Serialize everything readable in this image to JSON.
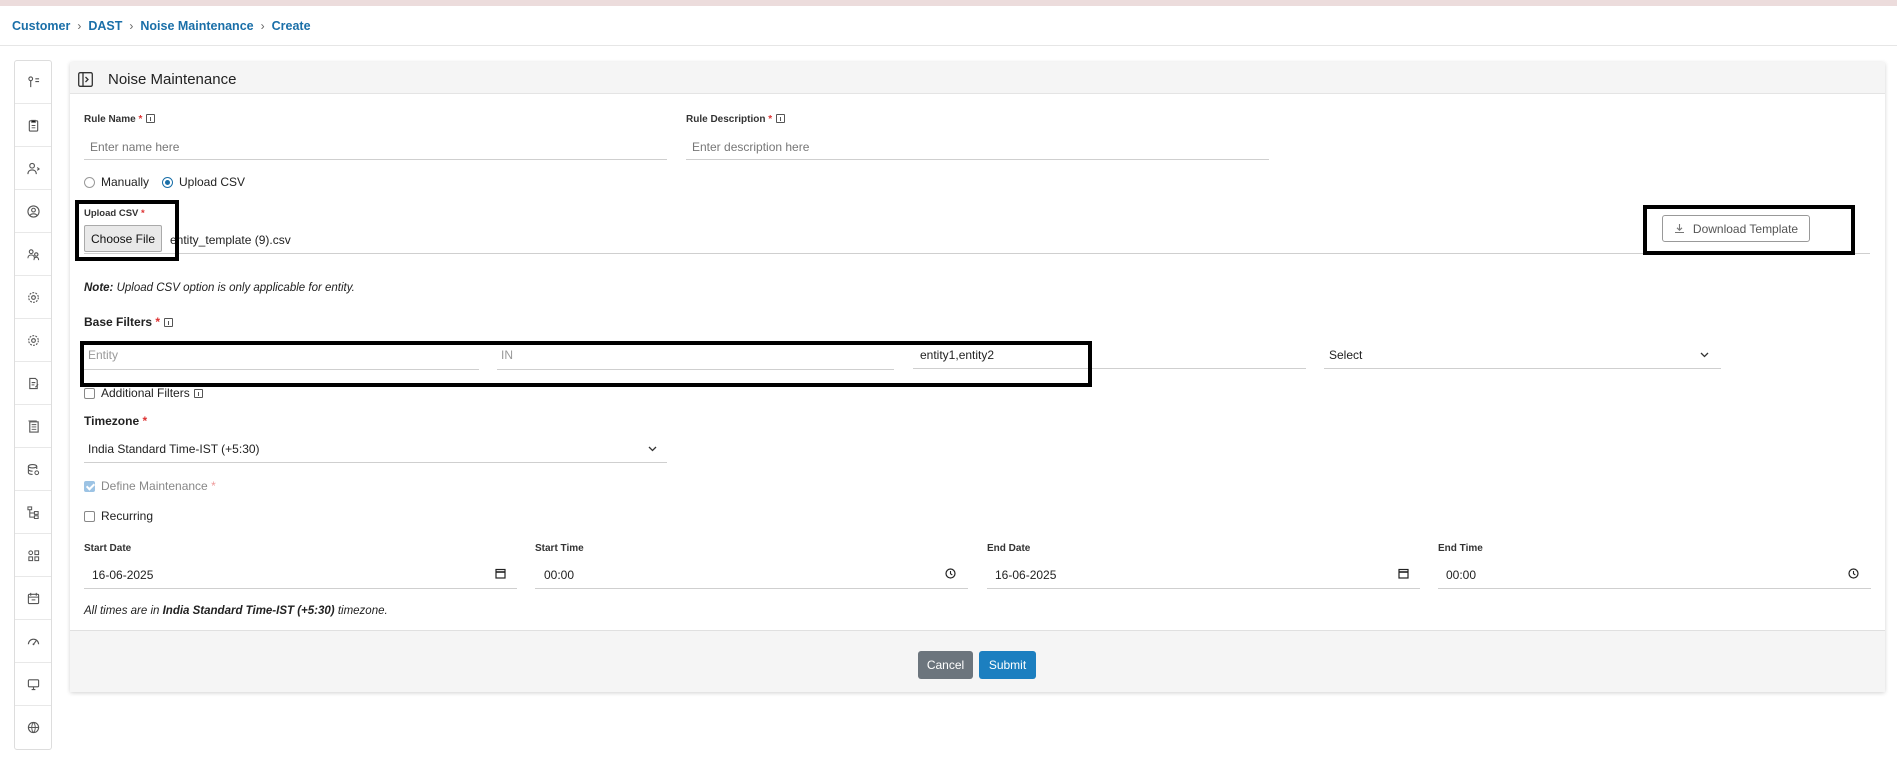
{
  "breadcrumb": [
    "Customer",
    "DAST",
    "Noise Maintenance",
    "Create"
  ],
  "sidebar_icons": [
    "flow-icon",
    "clipboard-icon",
    "user-gear-icon",
    "user-circle-icon",
    "users-icon",
    "settings-icon",
    "settings-cog-icon",
    "edit-document-icon",
    "reports-icon",
    "database-icon",
    "hierarchy-icon",
    "apps-grid-icon",
    "calendar-icon",
    "dashboard-gauge-icon",
    "monitor-icon",
    "globe-icon"
  ],
  "card": {
    "title": "Noise Maintenance"
  },
  "rule_name": {
    "label": "Rule Name",
    "placeholder": "Enter name here"
  },
  "rule_description": {
    "label": "Rule Description",
    "placeholder": "Enter description here"
  },
  "input_mode": {
    "options": [
      "Manually",
      "Upload CSV"
    ],
    "selected": "Upload CSV"
  },
  "upload": {
    "label": "Upload CSV",
    "button": "Choose File",
    "filename": "entity_template (9).csv",
    "download_button": "Download Template"
  },
  "note": {
    "bold": "Note:",
    "text": " Upload CSV option is only applicable for entity."
  },
  "base_filters": {
    "label": "Base Filters",
    "field": "Entity",
    "operator": "IN",
    "value": "entity1,entity2",
    "select": "Select"
  },
  "additional_filters": {
    "label": "Additional Filters",
    "checked": false
  },
  "timezone": {
    "label": "Timezone",
    "value": "India Standard Time-IST (+5:30)"
  },
  "define_maintenance": {
    "label": "Define Maintenance",
    "checked": true
  },
  "recurring": {
    "label": "Recurring",
    "checked": false
  },
  "schedule": {
    "start_date": {
      "label": "Start Date",
      "value": "16-06-2025"
    },
    "start_time": {
      "label": "Start Time",
      "value": "00:00"
    },
    "end_date": {
      "label": "End Date",
      "value": "16-06-2025"
    },
    "end_time": {
      "label": "End Time",
      "value": "00:00"
    }
  },
  "tz_note": {
    "prefix": "All times are in ",
    "bold": "India Standard Time-IST (+5:30)",
    "suffix": " timezone."
  },
  "buttons": {
    "cancel": "Cancel",
    "submit": "Submit"
  },
  "colors": {
    "link": "#1a6fa8",
    "submit": "#1c7fc0",
    "cancel": "#6c757d",
    "required": "#d33333"
  }
}
